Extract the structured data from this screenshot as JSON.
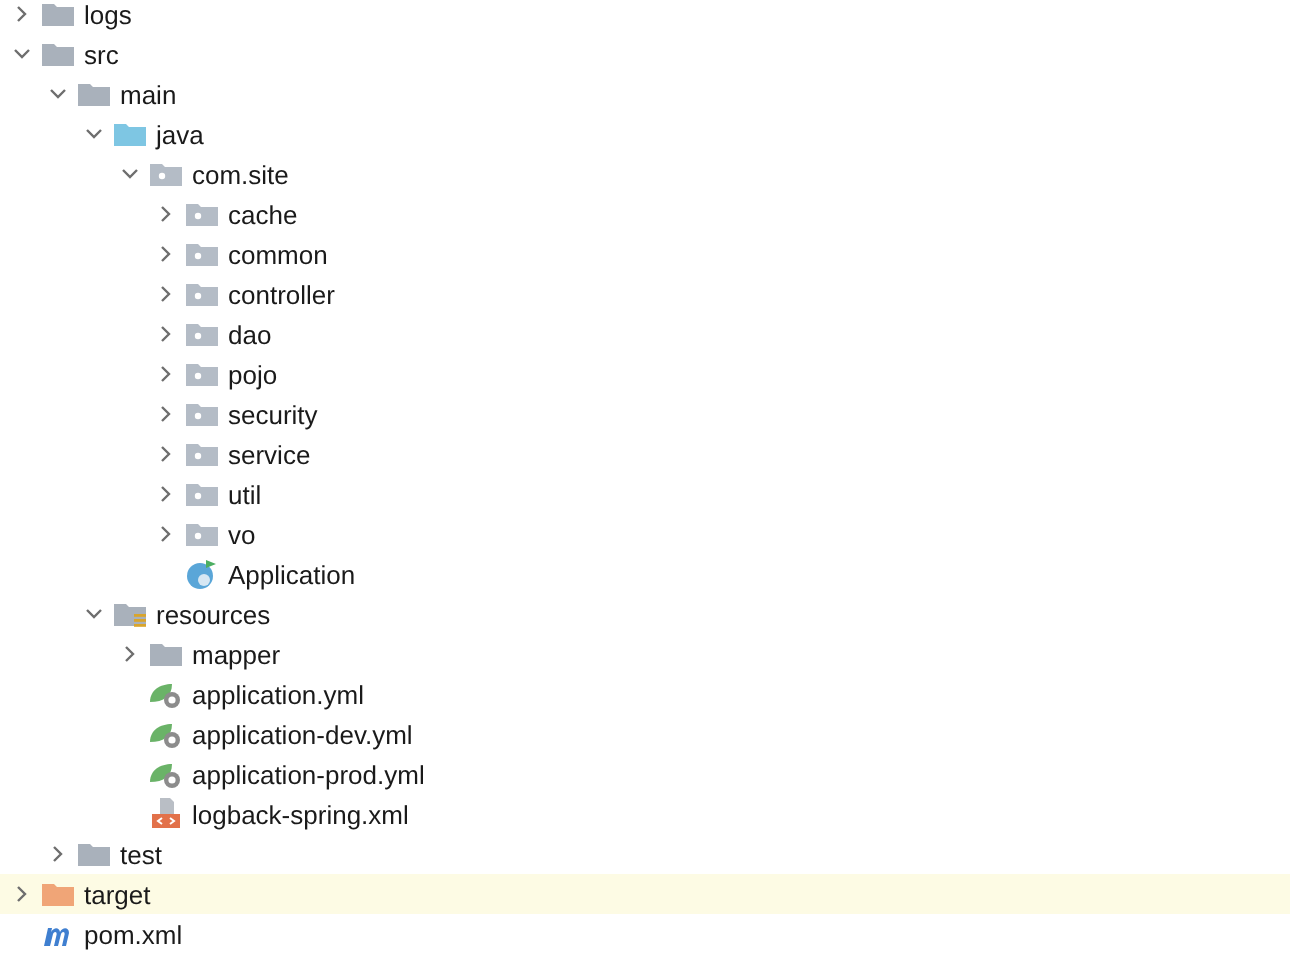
{
  "project_tree": [
    {
      "name": "logs",
      "kind": "folder",
      "expanded": false,
      "selected": false
    },
    {
      "name": "src",
      "kind": "folder",
      "expanded": true,
      "selected": false,
      "children": [
        {
          "name": "main",
          "kind": "folder",
          "expanded": true,
          "selected": false,
          "children": [
            {
              "name": "java",
              "kind": "source-folder",
              "expanded": true,
              "selected": false,
              "children": [
                {
                  "name": "com.site",
                  "kind": "package",
                  "expanded": true,
                  "selected": false,
                  "children": [
                    {
                      "name": "cache",
                      "kind": "package",
                      "expanded": false,
                      "selected": false
                    },
                    {
                      "name": "common",
                      "kind": "package",
                      "expanded": false,
                      "selected": false
                    },
                    {
                      "name": "controller",
                      "kind": "package",
                      "expanded": false,
                      "selected": false
                    },
                    {
                      "name": "dao",
                      "kind": "package",
                      "expanded": false,
                      "selected": false
                    },
                    {
                      "name": "pojo",
                      "kind": "package",
                      "expanded": false,
                      "selected": false
                    },
                    {
                      "name": "security",
                      "kind": "package",
                      "expanded": false,
                      "selected": false
                    },
                    {
                      "name": "service",
                      "kind": "package",
                      "expanded": false,
                      "selected": false
                    },
                    {
                      "name": "util",
                      "kind": "package",
                      "expanded": false,
                      "selected": false
                    },
                    {
                      "name": "vo",
                      "kind": "package",
                      "expanded": false,
                      "selected": false
                    },
                    {
                      "name": "Application",
                      "kind": "java-class",
                      "selected": false
                    }
                  ]
                }
              ]
            },
            {
              "name": "resources",
              "kind": "resources-folder",
              "expanded": true,
              "selected": false,
              "children": [
                {
                  "name": "mapper",
                  "kind": "folder",
                  "expanded": false,
                  "selected": false
                },
                {
                  "name": "application.yml",
                  "kind": "spring-config",
                  "selected": false
                },
                {
                  "name": "application-dev.yml",
                  "kind": "spring-config",
                  "selected": false
                },
                {
                  "name": "application-prod.yml",
                  "kind": "spring-config",
                  "selected": false
                },
                {
                  "name": "logback-spring.xml",
                  "kind": "xml-file",
                  "selected": false
                }
              ]
            }
          ]
        },
        {
          "name": "test",
          "kind": "folder",
          "expanded": false,
          "selected": false
        }
      ]
    },
    {
      "name": "target",
      "kind": "excluded-folder",
      "expanded": false,
      "selected": true
    },
    {
      "name": "pom.xml",
      "kind": "maven-file",
      "selected": false
    }
  ]
}
